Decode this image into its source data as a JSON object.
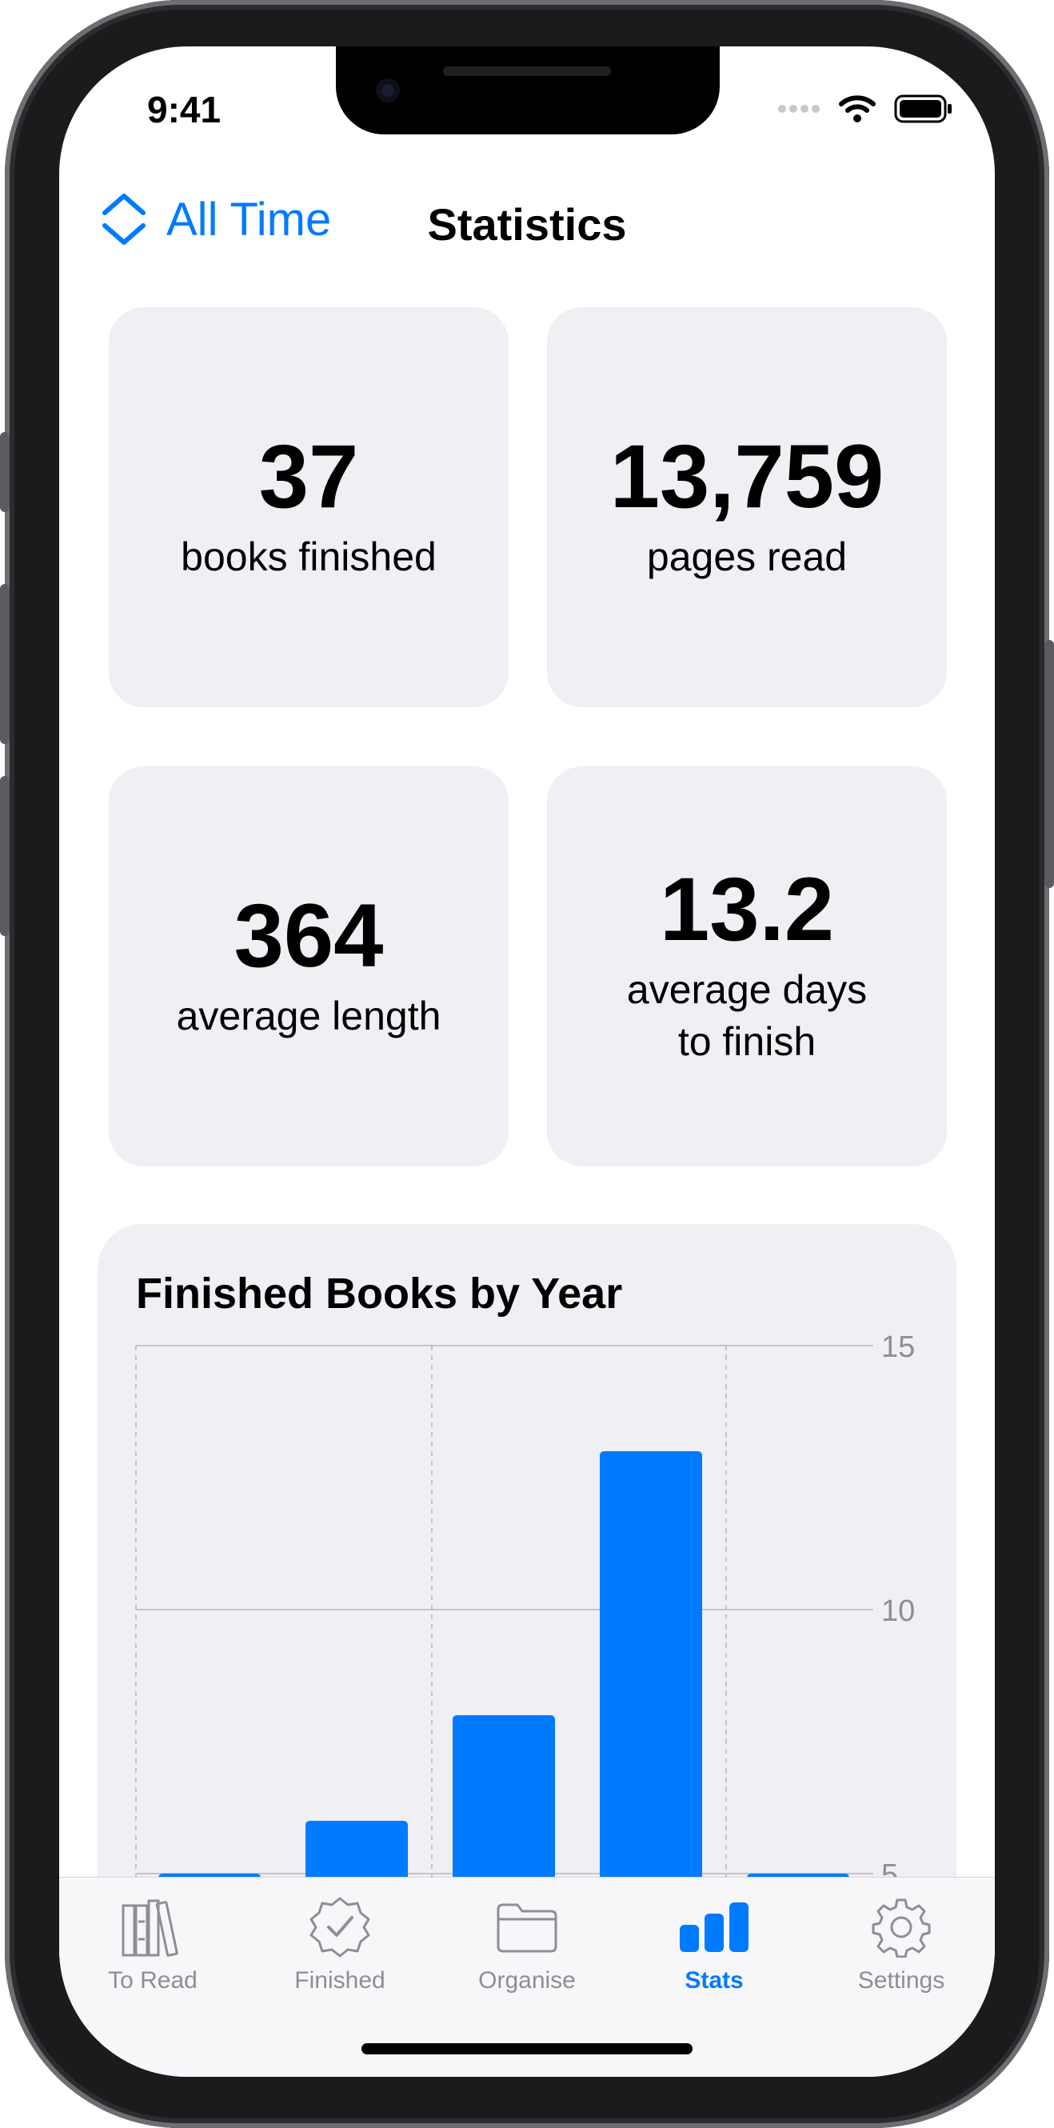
{
  "status_bar": {
    "time": "9:41"
  },
  "nav": {
    "scope_label": "All Time",
    "title": "Statistics"
  },
  "stats": [
    {
      "value": "37",
      "label": "books finished"
    },
    {
      "value": "13,759",
      "label": "pages read"
    },
    {
      "value": "364",
      "label": "average length"
    },
    {
      "value": "13.2",
      "label": "average days\nto finish"
    }
  ],
  "chart": {
    "title": "Finished Books by Year",
    "tick_labels": [
      "15",
      "10",
      "5"
    ]
  },
  "chart_data": {
    "type": "bar",
    "title": "Finished Books by Year",
    "categories": [
      "",
      "",
      "",
      "",
      ""
    ],
    "values": [
      5,
      6,
      8,
      13,
      5
    ],
    "ylim": [
      0,
      15
    ],
    "yticks": [
      5,
      10,
      15
    ],
    "grid": true,
    "color": "#007aff"
  },
  "tabbar": {
    "items": [
      {
        "label": "To Read",
        "icon": "books-icon",
        "active": false
      },
      {
        "label": "Finished",
        "icon": "checkmark-seal-icon",
        "active": false
      },
      {
        "label": "Organise",
        "icon": "folder-icon",
        "active": false
      },
      {
        "label": "Stats",
        "icon": "chart-bar-icon",
        "active": true
      },
      {
        "label": "Settings",
        "icon": "gear-icon",
        "active": false
      }
    ]
  },
  "colors": {
    "accent": "#007aff",
    "card_bg": "#efeff4",
    "inactive": "#8e8e93"
  }
}
